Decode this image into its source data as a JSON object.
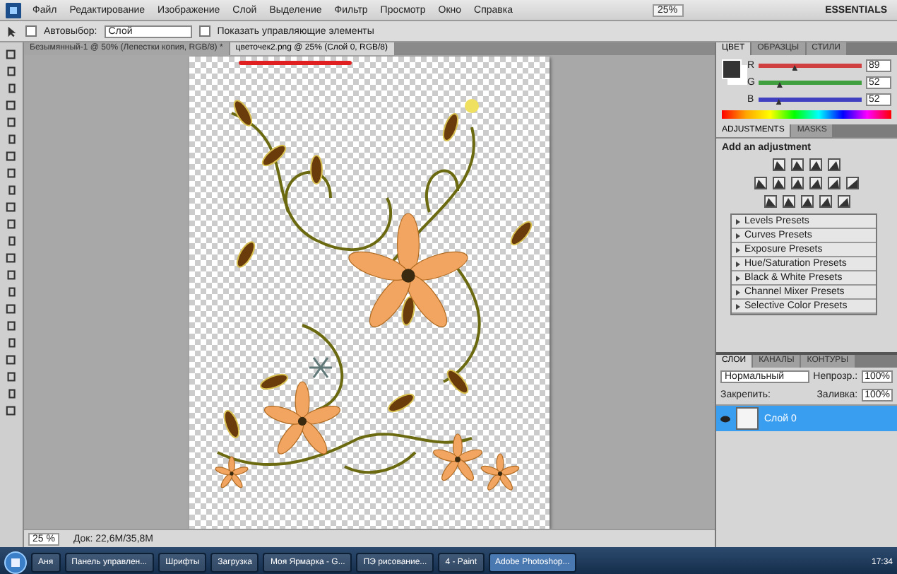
{
  "menu_bar": {
    "items": [
      "Файл",
      "Редактирование",
      "Изображение",
      "Слой",
      "Выделение",
      "Фильтр",
      "Просмотр",
      "Окно",
      "Справка"
    ],
    "zoom": "25%",
    "workspace": "ESSENTIALS"
  },
  "options_bar": {
    "auto_select_label": "Автовыбор:",
    "auto_select_checked": false,
    "target": "Слой",
    "show_controls_label": "Показать управляющие элементы",
    "show_controls_checked": false
  },
  "document_tabs": [
    {
      "label": "Безымянный-1 @ 50% (Лепестки копия, RGB/8) *",
      "selected": false,
      "underlined": false
    },
    {
      "label": "цветочек2.png @ 25% (Слой 0, RGB/8)",
      "selected": true,
      "underlined": true
    }
  ],
  "status_bar": {
    "zoom": "25 %",
    "doc_info": "Док: 22,6M/35,8M"
  },
  "color_panel": {
    "tabs": [
      {
        "label": "ЦВЕТ",
        "selected": true
      },
      {
        "label": "ОБРАЗЦЫ",
        "selected": false
      },
      {
        "label": "СТИЛИ",
        "selected": false
      }
    ],
    "channels": [
      {
        "name": "R",
        "level": 0.35,
        "value": "89",
        "color": "#d04040"
      },
      {
        "name": "G",
        "level": 0.2,
        "value": "52",
        "color": "#40a040"
      },
      {
        "name": "B",
        "level": 0.2,
        "value": "52",
        "color": "#4040c0"
      }
    ]
  },
  "adjustments_panel": {
    "tabs": [
      {
        "label": "ADJUSTMENTS",
        "selected": true
      },
      {
        "label": "MASKS",
        "selected": false
      }
    ],
    "heading": "Add an adjustment",
    "presets": [
      "Levels Presets",
      "Curves Presets",
      "Exposure Presets",
      "Hue/Saturation Presets",
      "Black & White Presets",
      "Channel Mixer Presets",
      "Selective Color Presets"
    ]
  },
  "layers_panel": {
    "tabs": [
      {
        "label": "СЛОИ",
        "selected": true
      },
      {
        "label": "КАНАЛЫ",
        "selected": false
      },
      {
        "label": "КОНТУРЫ",
        "selected": false
      }
    ],
    "blend_mode": "Нормальный",
    "opacity_label": "Непрозр.:",
    "opacity": "100%",
    "lock_label": "Закрепить:",
    "fill_label": "Заливка:",
    "fill": "100%",
    "layers": [
      {
        "name": "Слой 0",
        "selected": true,
        "visible": true
      }
    ]
  },
  "taskbar": {
    "items": [
      {
        "label": "Аня",
        "selected": false
      },
      {
        "label": "Панель управлен...",
        "selected": false
      },
      {
        "label": "Шрифты",
        "selected": false
      },
      {
        "label": "Загрузка",
        "selected": false
      },
      {
        "label": "Моя Ярмарка - G...",
        "selected": false
      },
      {
        "label": "ПЭ рисование...",
        "selected": false
      },
      {
        "label": "4 - Paint",
        "selected": false
      },
      {
        "label": "Adobe Photoshop...",
        "selected": true
      }
    ],
    "clock": "17:34"
  }
}
